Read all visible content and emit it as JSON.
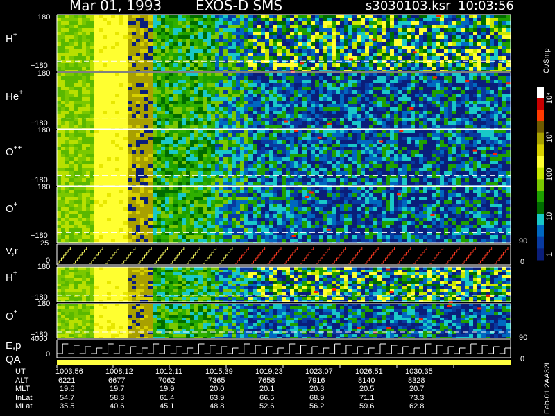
{
  "header": {
    "date": "Mar 01, 1993",
    "instrument": "EXOS-D SMS",
    "file": "s3030103.ksr",
    "time": "10:03:56"
  },
  "panels": {
    "h_plus": {
      "name": "H",
      "sup": "+",
      "top_tick": "180",
      "bottom_tick": "−180"
    },
    "he_plus": {
      "name": "He",
      "sup": "+",
      "top_tick": "180",
      "bottom_tick": "−180"
    },
    "o_pp": {
      "name": "O",
      "sup": "++",
      "top_tick": "180",
      "bottom_tick": "−180"
    },
    "o_plus": {
      "name": "O",
      "sup": "+",
      "top_tick": "180",
      "bottom_tick": "−180"
    },
    "vr": {
      "name": "V,r",
      "top_tick": "25",
      "bottom_tick": "0"
    },
    "h_plus_2": {
      "name": "H",
      "sup": "+",
      "top_tick": "180",
      "bottom_tick": "−180"
    },
    "o_plus_2": {
      "name": "O",
      "sup": "+",
      "top_tick": "180",
      "bottom_tick": "−180"
    },
    "ep": {
      "name": "E,p",
      "top_tick": "4000",
      "bottom_tick": "0"
    },
    "qa": {
      "name": "QA"
    }
  },
  "right_axis": {
    "upper_90": "90",
    "upper_0": "0",
    "lower_90": "90",
    "lower_0": "0"
  },
  "colorbar": {
    "unit": "Ct/Smp",
    "labels": [
      "10⁴",
      "10³",
      "100",
      "10",
      "1"
    ],
    "colors": [
      "#ffffff",
      "#c80000",
      "#ff3a00",
      "#6e5a00",
      "#a8a000",
      "#d8d000",
      "#ffff30",
      "#c8e800",
      "#7ac800",
      "#1ea000",
      "#006c00",
      "#18c8c8",
      "#0068c0",
      "#083aa0",
      "#0a1e7a"
    ]
  },
  "footer_code": "Feb-01 2AA32L",
  "orbit": {
    "labels": [
      "UT",
      "ALT",
      "MLT",
      "InLat",
      "MLat"
    ],
    "columns": [
      [
        "1003:56",
        "6221",
        "19.6",
        "54.7",
        "35.5"
      ],
      [
        "1008:12",
        "6677",
        "19.7",
        "58.3",
        "40.6"
      ],
      [
        "1012:11",
        "7062",
        "19.9",
        "61.4",
        "45.1"
      ],
      [
        "1015:39",
        "7365",
        "20.0",
        "63.9",
        "48.8"
      ],
      [
        "1019:23",
        "7658",
        "20.1",
        "66.5",
        "52.6"
      ],
      [
        "1023:07",
        "7916",
        "20.3",
        "68.9",
        "56.2"
      ],
      [
        "1026:51",
        "8140",
        "20.5",
        "71.1",
        "59.6"
      ],
      [
        "1030:35",
        "8328",
        "20.7",
        "73.3",
        "62.8"
      ]
    ]
  },
  "chart_data": {
    "type": "heatmap",
    "title": "Mar 01, 1993   EXOS-D SMS",
    "x": [
      "1003:56",
      "1008:12",
      "1012:11",
      "1015:39",
      "1019:23",
      "1023:07",
      "1026:51",
      "1030:35"
    ],
    "colorbar_unit": "Ct/Smp",
    "colorbar_ticks": [
      1,
      10,
      100,
      1000,
      10000
    ],
    "log_scale_colorbar": true,
    "series": [
      {
        "name": "H+",
        "ylim": [
          -180,
          180
        ]
      },
      {
        "name": "He+",
        "ylim": [
          -180,
          180
        ]
      },
      {
        "name": "O++",
        "ylim": [
          -180,
          180
        ]
      },
      {
        "name": "O+",
        "ylim": [
          -180,
          180
        ]
      },
      {
        "name": "V,r",
        "ylim": [
          0,
          25
        ]
      },
      {
        "name": "H+",
        "ylim": [
          -180,
          180
        ]
      },
      {
        "name": "O+",
        "ylim": [
          -180,
          180
        ]
      },
      {
        "name": "E,p",
        "ylim": [
          0,
          4000
        ]
      }
    ]
  }
}
